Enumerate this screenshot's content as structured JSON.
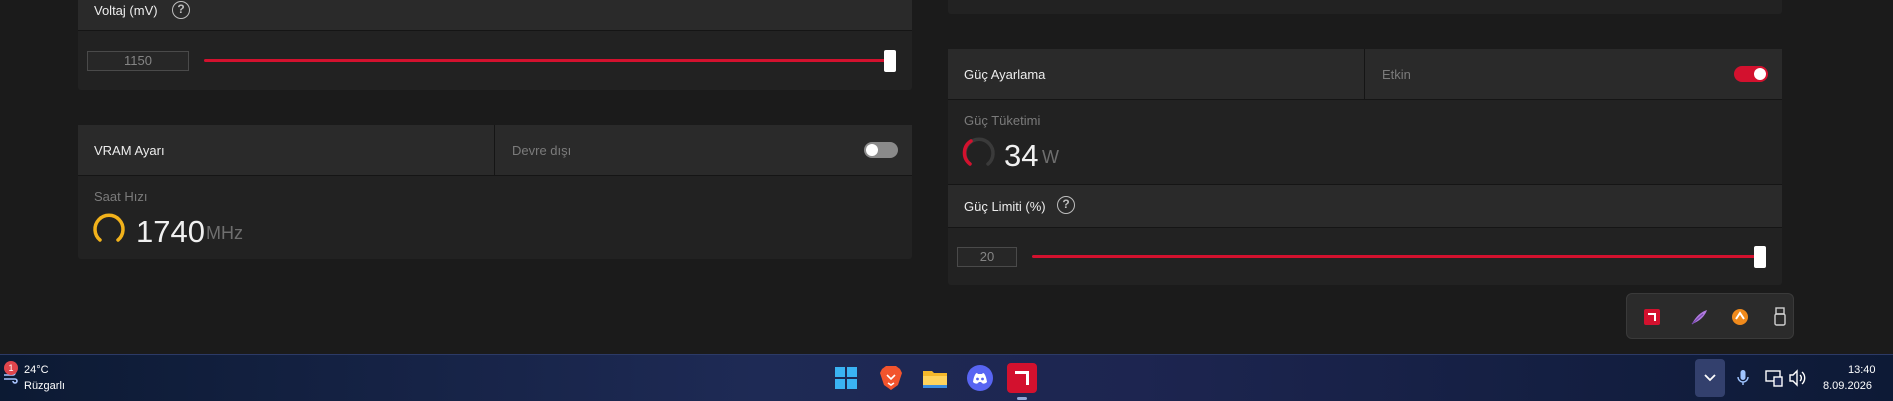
{
  "voltage": {
    "label": "Voltaj (mV)",
    "value": "1150",
    "slider_fraction": 1.0
  },
  "vram": {
    "label": "VRAM Ayarı",
    "state_label": "Devre dışı",
    "toggle_on": false,
    "clock_label": "Saat Hızı",
    "clock_value": "1740",
    "clock_unit": "MHz",
    "gauge_color": "#f2b21b"
  },
  "power_tuning": {
    "label": "Güç Ayarlama",
    "state_label": "Etkin",
    "toggle_on": true,
    "consumption_label": "Güç Tüketimi",
    "consumption_value": "34",
    "consumption_unit": "W",
    "gauge_color": "#d3112e",
    "limit_label": "Güç Limiti (%)",
    "limit_value": "20",
    "limit_slider_fraction": 1.0
  },
  "accent_color": "#d3112e",
  "overlay_icons": [
    "amd-radeon-icon",
    "feather-icon",
    "orange-app-icon",
    "usb-icon"
  ],
  "taskbar": {
    "weather_temp": "24°C",
    "weather_desc": "Rüzgarlı",
    "weather_badge": "1",
    "apps": [
      "windows-start-icon",
      "brave-browser-icon",
      "file-explorer-icon",
      "discord-icon",
      "amd-software-icon"
    ],
    "time": "13:40",
    "date": "8.09.2026"
  }
}
